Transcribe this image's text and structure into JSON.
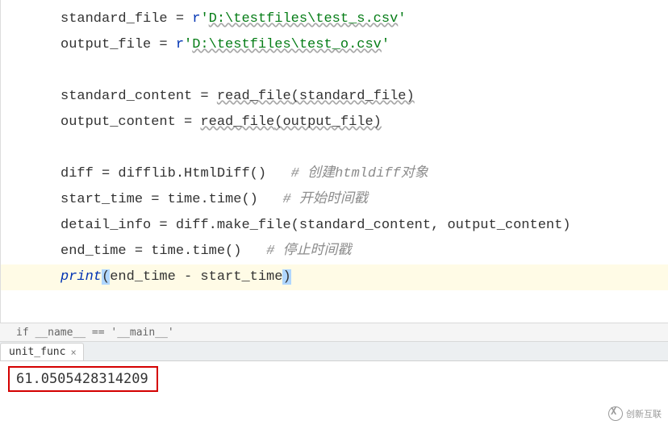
{
  "code": {
    "line1_var": "standard_file",
    "line1_eq": " = ",
    "line1_prefix": "r",
    "line1_q1": "'",
    "line1_path": "D:\\testfiles\\test_s.csv",
    "line1_q2": "'",
    "line2_var": "output_file",
    "line2_eq": " = ",
    "line2_prefix": "r",
    "line2_q1": "'",
    "line2_path": "D:\\testfiles\\test_o.csv",
    "line2_q2": "'",
    "line4_var": "standard_content",
    "line4_eq": " = ",
    "line4_call": "read_file",
    "line4_arg": "(standard_file)",
    "line5_var": "output_content",
    "line5_eq": " = ",
    "line5_call": "read_file",
    "line5_arg": "(output_file)",
    "line7_var": "diff",
    "line7_eq": " = ",
    "line7_obj": "difflib.HtmlDiff()",
    "line7_sp": "   ",
    "line7_comment": "# 创建htmldiff对象",
    "line8_var": "start_time",
    "line8_eq": " = ",
    "line8_obj": "time.time()",
    "line8_sp": "   ",
    "line8_comment": "# 开始时间戳",
    "line9_var": "detail_info",
    "line9_eq": " = ",
    "line9_obj": "diff.make_file(standard_content, output_content)",
    "line10_var": "end_time",
    "line10_eq": " = ",
    "line10_obj": "time.time()",
    "line10_sp": "   ",
    "line10_comment": "# 停止时间戳",
    "line11_print": "print",
    "line11_p1": "(",
    "line11_expr": "end_time - start_time",
    "line11_p2": ")"
  },
  "breadcrumb": {
    "text": "if __name__ == '__main__'"
  },
  "tab": {
    "label": "unit_func",
    "close": "×"
  },
  "output": {
    "value": "61.0505428314209"
  },
  "watermark": {
    "label": "创新互联"
  }
}
